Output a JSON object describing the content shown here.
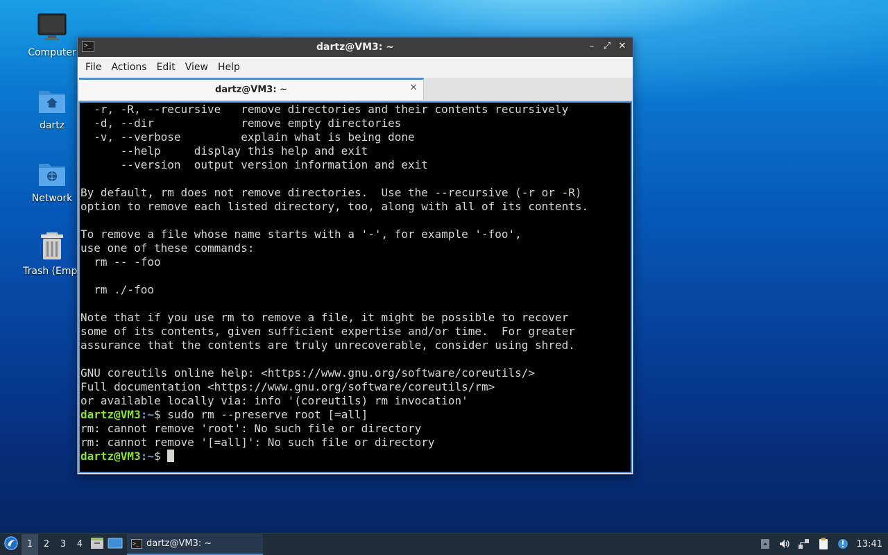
{
  "desktop": {
    "icons": [
      {
        "label": "Computer"
      },
      {
        "label": "dartz"
      },
      {
        "label": "Network"
      },
      {
        "label": "Trash (Empt"
      }
    ]
  },
  "window": {
    "title": "dartz@VM3: ~",
    "buttons": {
      "minimize": "–",
      "maximize": "⤢",
      "close": "✕"
    },
    "menu": {
      "file": "File",
      "actions": "Actions",
      "edit": "Edit",
      "view": "View",
      "help": "Help"
    },
    "tab": {
      "title": "dartz@VM3: ~",
      "close": "×"
    }
  },
  "terminal": {
    "lines": [
      "  -r, -R, --recursive   remove directories and their contents recursively",
      "  -d, --dir             remove empty directories",
      "  -v, --verbose         explain what is being done",
      "      --help     display this help and exit",
      "      --version  output version information and exit",
      "",
      "By default, rm does not remove directories.  Use the --recursive (-r or -R)",
      "option to remove each listed directory, too, along with all of its contents.",
      "",
      "To remove a file whose name starts with a '-', for example '-foo',",
      "use one of these commands:",
      "  rm -- -foo",
      "",
      "  rm ./-foo",
      "",
      "Note that if you use rm to remove a file, it might be possible to recover",
      "some of its contents, given sufficient expertise and/or time.  For greater",
      "assurance that the contents are truly unrecoverable, consider using shred.",
      "",
      "GNU coreutils online help: <https://www.gnu.org/software/coreutils/>",
      "Full documentation <https://www.gnu.org/software/coreutils/rm>",
      "or available locally via: info '(coreutils) rm invocation'"
    ],
    "prompt_user": "dartz@VM3",
    "prompt_path": ":~",
    "prompt_symbol": "$ ",
    "command": "sudo rm --preserve root [=all]",
    "errors": [
      "rm: cannot remove 'root': No such file or directory",
      "rm: cannot remove '[=all]': No such file or directory"
    ]
  },
  "taskbar": {
    "workspaces": [
      "1",
      "2",
      "3",
      "4"
    ],
    "active_workspace": "1",
    "task_label": "dartz@VM3: ~",
    "clock": "13:41"
  },
  "colors": {
    "accent": "#4a8ed8",
    "prompt_user": "#8ae234",
    "prompt_path": "#729fcf",
    "terminal_bg": "#000000",
    "terminal_fg": "#d3d7cf"
  }
}
